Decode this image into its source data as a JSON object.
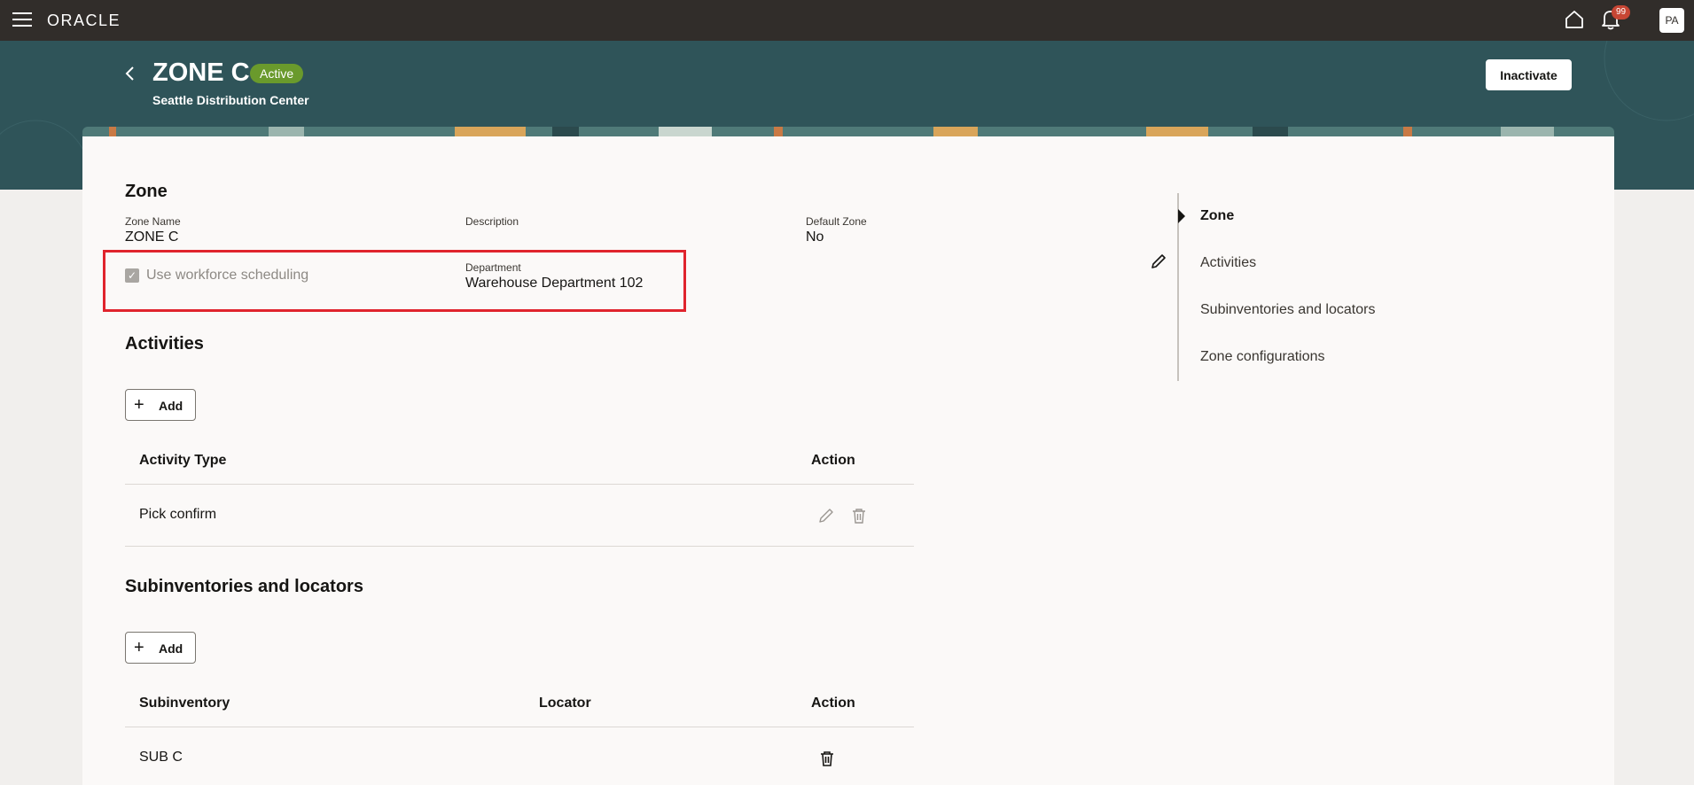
{
  "topbar": {
    "logo": "ORACLE",
    "notification_count": "99",
    "avatar_initials": "PA"
  },
  "header": {
    "title": "ZONE C",
    "status": "Active",
    "subtitle": "Seattle Distribution Center",
    "inactivate_label": "Inactivate"
  },
  "zone": {
    "section_title": "Zone",
    "zone_name_label": "Zone Name",
    "zone_name_value": "ZONE C",
    "description_label": "Description",
    "default_zone_label": "Default Zone",
    "default_zone_value": "No",
    "workforce_label": "Use workforce scheduling",
    "workforce_checked": true,
    "department_label": "Department",
    "department_value": "Warehouse Department 102"
  },
  "activities": {
    "section_title": "Activities",
    "add_label": "Add",
    "columns": [
      "Activity Type",
      "Action"
    ],
    "rows": [
      {
        "activity_type": "Pick confirm"
      }
    ]
  },
  "subinventories": {
    "section_title": "Subinventories and locators",
    "add_label": "Add",
    "columns": [
      "Subinventory",
      "Locator",
      "Action"
    ],
    "rows": [
      {
        "subinventory": "SUB C",
        "locator": ""
      }
    ]
  },
  "side_nav": {
    "items": [
      {
        "label": "Zone",
        "active": true
      },
      {
        "label": "Activities",
        "active": false
      },
      {
        "label": "Subinventories and locators",
        "active": false
      },
      {
        "label": "Zone configurations",
        "active": false
      }
    ]
  },
  "colors": {
    "topbar": "#312d2a",
    "header_band": "#2f5459",
    "status_badge": "#6a9a2c",
    "highlight": "#e0242d",
    "notification_badge": "#c74634"
  }
}
